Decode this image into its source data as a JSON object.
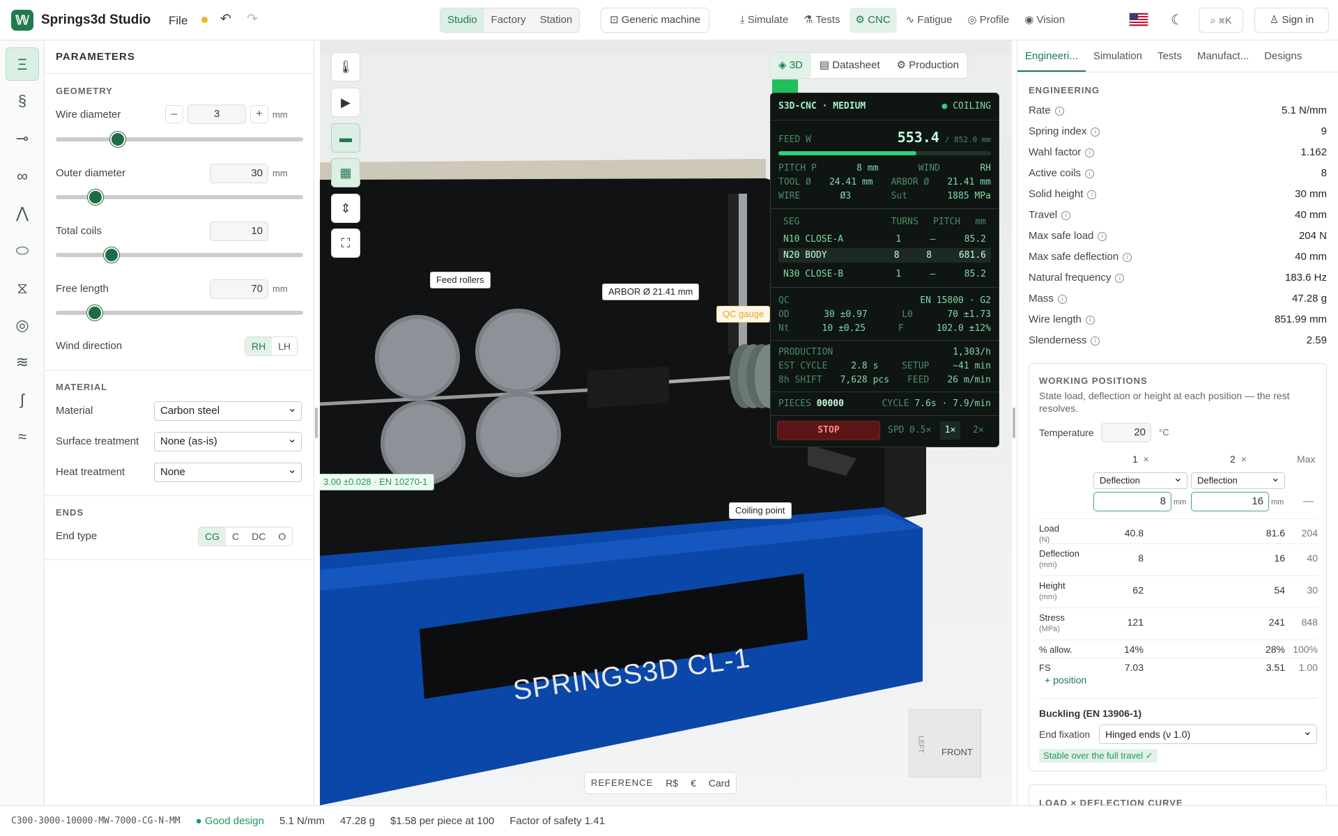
{
  "app": {
    "title": "Springs3d Studio",
    "logo": "springs-logo",
    "file": "File",
    "undo": "↶",
    "redo": "↷"
  },
  "topbar": {
    "modes": [
      "Studio",
      "Factory",
      "Station"
    ],
    "machine": "Generic machine",
    "links": [
      "Simulate",
      "Tests",
      "CNC",
      "Fatigue",
      "Profile",
      "Vision"
    ],
    "search_label": "⌘K",
    "signin": "Sign in"
  },
  "params": {
    "title": "PARAMETERS",
    "geometry": {
      "heading": "GEOMETRY",
      "wire_diameter": {
        "label": "Wire diameter",
        "value": "3",
        "unit": "mm",
        "minus": "–",
        "plus": "+"
      },
      "outer_diameter": {
        "label": "Outer diameter",
        "value": "30",
        "unit": "mm"
      },
      "total_coils": {
        "label": "Total coils",
        "value": "10"
      },
      "free_length": {
        "label": "Free length",
        "value": "70",
        "unit": "mm"
      },
      "wind_direction": {
        "label": "Wind direction",
        "options": [
          "RH",
          "LH"
        ],
        "selected": "RH"
      }
    },
    "material": {
      "heading": "MATERIAL",
      "material": {
        "label": "Material",
        "value": "Carbon steel"
      },
      "surface": {
        "label": "Surface treatment",
        "value": "None (as-is)"
      },
      "heat": {
        "label": "Heat treatment",
        "value": "None"
      }
    },
    "ends": {
      "heading": "ENDS",
      "end_type": {
        "label": "End type",
        "options": [
          "CG",
          "C",
          "DC",
          "O"
        ],
        "selected": "CG"
      }
    }
  },
  "viewport": {
    "tabs": [
      "3D",
      "Datasheet",
      "Production"
    ],
    "callouts": {
      "feed": "Feed rollers",
      "arbor": "ARBOR Ø 21.41 mm",
      "qc": "QC gauge",
      "wire": "3.00 ±0.028 · EN 10270-1",
      "coil": "Coiling point"
    },
    "machine_label": "SPRINGS3D CL-1",
    "cube": {
      "front": "FRONT",
      "left": "LEFT"
    },
    "bottom": [
      "REFERENCE",
      "R$",
      "€",
      "Card"
    ]
  },
  "cnc": {
    "header": "S3D-CNC · MEDIUM",
    "status": "COILING",
    "feed_label": "FEED W",
    "feed_value": "553.4",
    "feed_total": "/ 852.0 mm",
    "feed_progress": 0.65,
    "pitch": {
      "l": "PITCH P",
      "v": "8 mm",
      "l2": "WIND",
      "v2": "RH"
    },
    "tool": {
      "l": "TOOL Ø",
      "v": "24.41 mm",
      "l2": "ARBOR Ø",
      "v2": "21.41 mm"
    },
    "wire": {
      "l": "WIRE",
      "v": "Ø3",
      "l2": "Sut",
      "v2": "1885 MPa"
    },
    "seg_head": [
      "SEG",
      "TURNS",
      "PITCH",
      "mm"
    ],
    "segments": [
      [
        "N10 CLOSE-A",
        "1",
        "—",
        "85.2"
      ],
      [
        "N20 BODY",
        "8",
        "8",
        "681.6"
      ],
      [
        "N30 CLOSE-B",
        "1",
        "—",
        "85.2"
      ]
    ],
    "qc": {
      "l": "QC",
      "std": "EN 15800 · G2",
      "od_l": "OD",
      "od": "30 ±0.97",
      "l0_l": "L0",
      "l0": "70 ±1.73",
      "nt_l": "Nt",
      "nt": "10 ±0.25",
      "f_l": "F",
      "f": "102.0 ±12%"
    },
    "prod": {
      "l": "PRODUCTION",
      "rate": "1,303/h",
      "cyc_l": "EST CYCLE",
      "cyc": "2.8 s",
      "setup_l": "SETUP",
      "setup": "~41 min",
      "shift_l": "8h SHIFT",
      "shift": "7,628 pcs",
      "feed_l": "FEED",
      "feed": "26 m/min"
    },
    "pieces_l": "PIECES",
    "pieces": "00000",
    "cycle_l": "CYCLE",
    "cycle": "7.6s · 7.9/min",
    "stop": "STOP",
    "spd": "SPD",
    "speeds": [
      "0.5×",
      "1×",
      "2×"
    ]
  },
  "right": {
    "tabs": [
      "Engineeri...",
      "Simulation",
      "Tests",
      "Manufact...",
      "Designs"
    ],
    "eng_heading": "ENGINEERING",
    "eng": [
      [
        "Rate",
        "5.1 N/mm"
      ],
      [
        "Spring index",
        "9"
      ],
      [
        "Wahl factor",
        "1.162"
      ],
      [
        "Active coils",
        "8"
      ],
      [
        "Solid height",
        "30 mm"
      ],
      [
        "Travel",
        "40 mm"
      ],
      [
        "Max safe load",
        "204 N"
      ],
      [
        "Max safe deflection",
        "40 mm"
      ],
      [
        "Natural frequency",
        "183.6 Hz"
      ],
      [
        "Mass",
        "47.28 g"
      ],
      [
        "Wire length",
        "851.99 mm"
      ],
      [
        "Slenderness",
        "2.59"
      ]
    ],
    "wp": {
      "heading": "WORKING POSITIONS",
      "desc": "State load, deflection or height at each position — the rest resolves.",
      "temp_label": "Temperature",
      "temp": "20",
      "temp_unit": "°C",
      "col1": "1",
      "col2": "2",
      "colmax": "Max",
      "close": "×",
      "sel1": "Deflection",
      "sel2": "Deflection",
      "in1": "8",
      "in2": "16",
      "unit": "mm",
      "dash": "—",
      "rows": [
        [
          "Load",
          "(N)",
          "40.8",
          "81.6",
          "204"
        ],
        [
          "Deflection",
          "(mm)",
          "8",
          "16",
          "40"
        ],
        [
          "Height",
          "(mm)",
          "62",
          "54",
          "30"
        ],
        [
          "Stress",
          "(MPa)",
          "121",
          "241",
          "848"
        ],
        [
          "% allow.",
          "",
          "14%",
          "28%",
          "100%"
        ],
        [
          "FS",
          "",
          "7.03",
          "3.51",
          "1.00"
        ]
      ],
      "add": "+ position"
    },
    "buckling": {
      "title": "Buckling (EN 13906-1)",
      "fix_label": "End fixation",
      "fix": "Hinged ends (ν 1.0)",
      "status": "Stable over the full travel ✓"
    },
    "curve_heading": "LOAD × DEFLECTION CURVE"
  },
  "footer": {
    "code": "C300-3000-10000-MW-7000-CG-N-MM",
    "status": "Good design",
    "rate": "5.1 N/mm",
    "mass": "47.28 g",
    "price": "$1.58 per piece at 100",
    "fos": "Factor of safety 1.41"
  },
  "colors": {
    "accent": "#1f7a4d",
    "cnc_bg": "#0f1512",
    "machine_blue": "#0a44a8"
  }
}
